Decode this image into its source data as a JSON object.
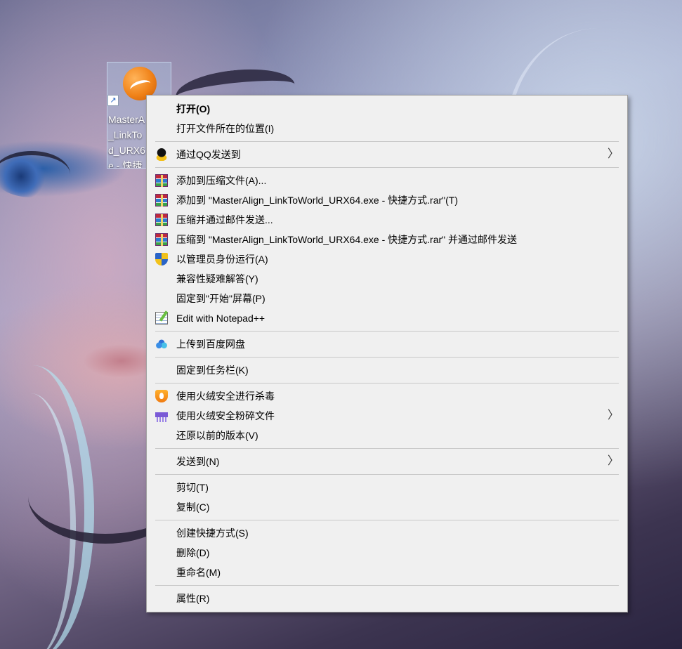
{
  "desktop": {
    "shortcut_label": "MasterA\n_LinkTo\nd_URX6\ne - 快捷",
    "shortcut_arrow": "↗"
  },
  "menu": {
    "items": {
      "open": "打开(O)",
      "open_location": "打开文件所在的位置(I)",
      "send_qq": "通过QQ发送到",
      "add_archive": "添加到压缩文件(A)...",
      "add_to_named_rar": "添加到 \"MasterAlign_LinkToWorld_URX64.exe - 快捷方式.rar\"(T)",
      "compress_email": "压缩并通过邮件发送...",
      "compress_named_email": "压缩到 \"MasterAlign_LinkToWorld_URX64.exe - 快捷方式.rar\" 并通过邮件发送",
      "run_as_admin": "以管理员身份运行(A)",
      "compat_troubleshoot": "兼容性疑难解答(Y)",
      "pin_start": "固定到\"开始\"屏幕(P)",
      "edit_notepad": "Edit with Notepad++",
      "upload_baidu": "上传到百度网盘",
      "pin_taskbar": "固定到任务栏(K)",
      "huorong_scan": "使用火绒安全进行杀毒",
      "huorong_shred": "使用火绒安全粉碎文件",
      "restore_versions": "还原以前的版本(V)",
      "send_to": "发送到(N)",
      "cut": "剪切(T)",
      "copy": "复制(C)",
      "create_shortcut": "创建快捷方式(S)",
      "delete": "删除(D)",
      "rename": "重命名(M)",
      "properties": "属性(R)"
    },
    "submenu_arrow": "〉"
  }
}
